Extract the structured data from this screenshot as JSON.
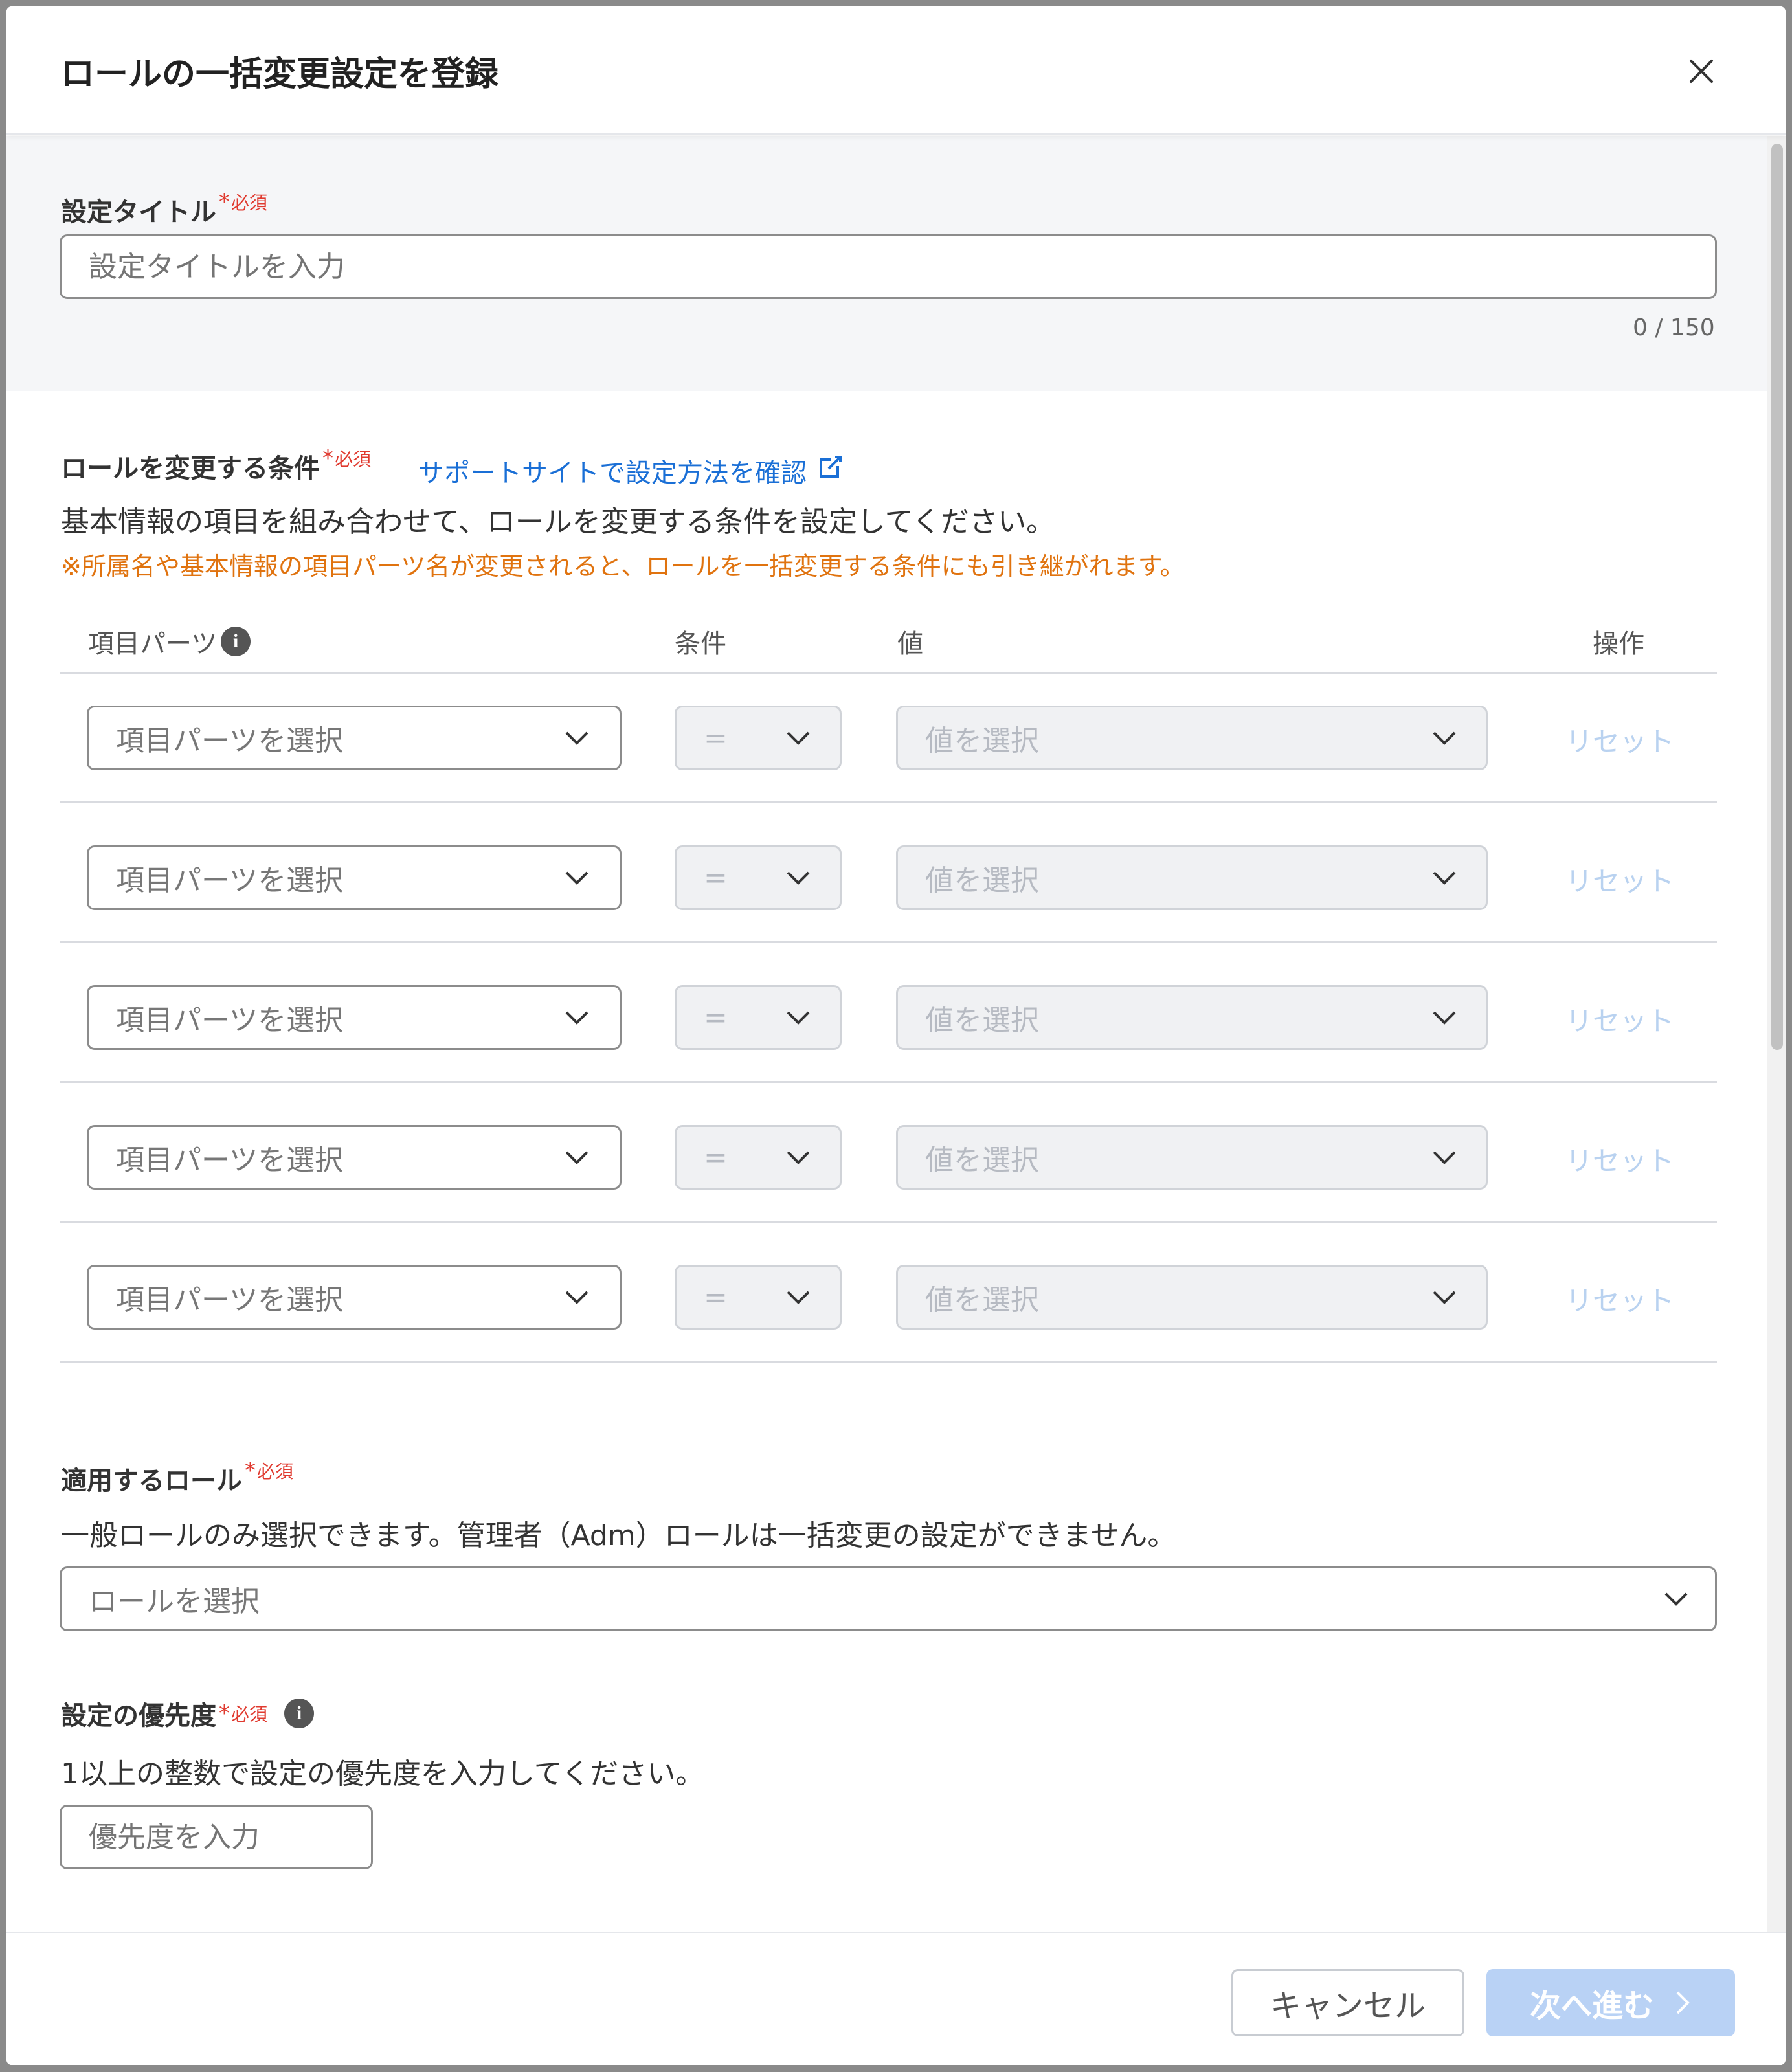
{
  "dialog": {
    "title": "ロールの一括変更設定を登録"
  },
  "title_field": {
    "label": "設定タイトル",
    "required_star": "*",
    "required_text": "必須",
    "placeholder": "設定タイトルを入力",
    "counter": "0 / 150"
  },
  "conditions": {
    "label": "ロールを変更する条件",
    "required_star": "*",
    "required_text": "必須",
    "support_link": "サポートサイトで設定方法を確認",
    "description": "基本情報の項目を組み合わせて、ロールを変更する条件を設定してください。",
    "note": "※所属名や基本情報の項目パーツ名が変更されると、ロールを一括変更する条件にも引き継がれます。",
    "columns": {
      "item": "項目パーツ",
      "condition": "条件",
      "value": "値",
      "action": "操作"
    },
    "rows": [
      {
        "item": "項目パーツを選択",
        "operator": "=",
        "value": "値を選択",
        "action": "リセット"
      },
      {
        "item": "項目パーツを選択",
        "operator": "=",
        "value": "値を選択",
        "action": "リセット"
      },
      {
        "item": "項目パーツを選択",
        "operator": "=",
        "value": "値を選択",
        "action": "リセット"
      },
      {
        "item": "項目パーツを選択",
        "operator": "=",
        "value": "値を選択",
        "action": "リセット"
      },
      {
        "item": "項目パーツを選択",
        "operator": "=",
        "value": "値を選択",
        "action": "リセット"
      }
    ]
  },
  "role": {
    "label": "適用するロール",
    "required_star": "*",
    "required_text": "必須",
    "description": "一般ロールのみ選択できます。管理者（Adm）ロールは一括変更の設定ができません。",
    "placeholder": "ロールを選択"
  },
  "priority": {
    "label": "設定の優先度",
    "required_star": "*",
    "required_text": "必須",
    "description": "1以上の整数で設定の優先度を入力してください。",
    "placeholder": "優先度を入力"
  },
  "footer": {
    "cancel": "キャンセル",
    "next": "次へ進む"
  }
}
